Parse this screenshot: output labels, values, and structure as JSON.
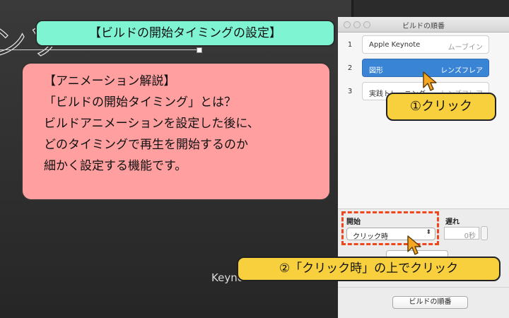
{
  "slide": {
    "title_fragment": "ンソ",
    "footer": "Keynote.stud.com"
  },
  "panel": {
    "title": "ビルドの順番",
    "builds": [
      {
        "number": "1",
        "name": "Apple Keynote",
        "effect": "ムーブイン",
        "selected": false
      },
      {
        "number": "2",
        "name": "図形",
        "effect": "レンズフレア",
        "selected": true
      },
      {
        "number": "3",
        "name": "実践トレーニング",
        "effect": "レンズフレア",
        "selected": false
      }
    ],
    "start_label": "開始",
    "start_value": "クリック時",
    "delay_label": "遅れ",
    "delay_value": "0秒",
    "build_order_button": "ビルドの順番"
  },
  "annotations": {
    "heading": "【ビルドの開始タイミングの設定】",
    "explain_lines": [
      "【アニメーション解説】",
      "「ビルドの開始タイミング」とは？",
      "ビルドアニメーションを設定した後に、",
      "どのタイミングで再生を開始するのか",
      "細かく設定する機能です。"
    ],
    "step1": "①クリック",
    "step2": "②「クリック時」の上でクリック"
  },
  "colors": {
    "heading_bg": "#7ef4d3",
    "explain_bg": "#ff9f9f",
    "step_bg": "#f8cf3d",
    "highlight": "#f0461c",
    "selected_row": "#3a84d6",
    "cursor": "#f5a623"
  },
  "icons": [
    "close-icon",
    "minimize-icon",
    "zoom-icon",
    "pointer-cursor-icon",
    "popup-arrows-icon",
    "stepper-icon"
  ]
}
